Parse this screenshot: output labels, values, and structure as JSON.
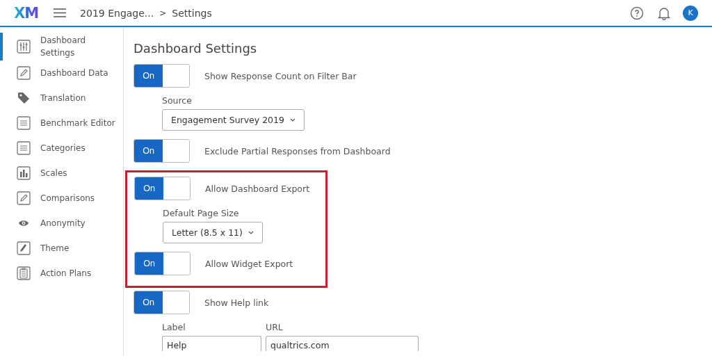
{
  "topbar": {
    "logo": "XM",
    "breadcrumb": "2019 Engage...",
    "separator": ">",
    "page": "Settings",
    "avatar": "K"
  },
  "sidebar": {
    "items": [
      {
        "label": "Dashboard Settings",
        "kind": "sliders",
        "selected": true
      },
      {
        "label": "Dashboard Data",
        "kind": "pencil",
        "selected": false
      },
      {
        "label": "Translation",
        "kind": "tag",
        "selected": false
      },
      {
        "label": "Benchmark Editor",
        "kind": "lines",
        "selected": false
      },
      {
        "label": "Categories",
        "kind": "lines",
        "selected": false
      },
      {
        "label": "Scales",
        "kind": "bars",
        "selected": false
      },
      {
        "label": "Comparisons",
        "kind": "pencil",
        "selected": false
      },
      {
        "label": "Anonymity",
        "kind": "eye",
        "selected": false
      },
      {
        "label": "Theme",
        "kind": "brush",
        "selected": false
      },
      {
        "label": "Action Plans",
        "kind": "clipboard",
        "selected": false
      }
    ]
  },
  "title": "Dashboard Settings",
  "groups": [
    {
      "highlighted": false,
      "items": [
        {
          "kind": "toggle",
          "on": true,
          "state_label": "On",
          "label": "Show Response Count on Filter Bar"
        },
        {
          "kind": "dropdown",
          "label": "Source",
          "value": "Engagement Survey 2019"
        },
        {
          "kind": "toggle",
          "on": true,
          "state_label": "On",
          "label": "Exclude Partial Responses from Dashboard"
        }
      ]
    },
    {
      "highlighted": true,
      "items": [
        {
          "kind": "toggle",
          "on": true,
          "state_label": "On",
          "label": "Allow Dashboard Export"
        },
        {
          "kind": "dropdown",
          "label": "Default Page Size",
          "value": "Letter (8.5 x 11)"
        },
        {
          "kind": "toggle",
          "on": true,
          "state_label": "On",
          "label": "Allow Widget Export"
        }
      ]
    },
    {
      "highlighted": false,
      "items": [
        {
          "kind": "toggle",
          "on": true,
          "state_label": "On",
          "label": "Show Help link"
        },
        {
          "kind": "fields",
          "fields": [
            {
              "label": "Label",
              "value": "Help"
            },
            {
              "label": "URL",
              "value": "qualtrics.com"
            }
          ]
        }
      ]
    }
  ]
}
